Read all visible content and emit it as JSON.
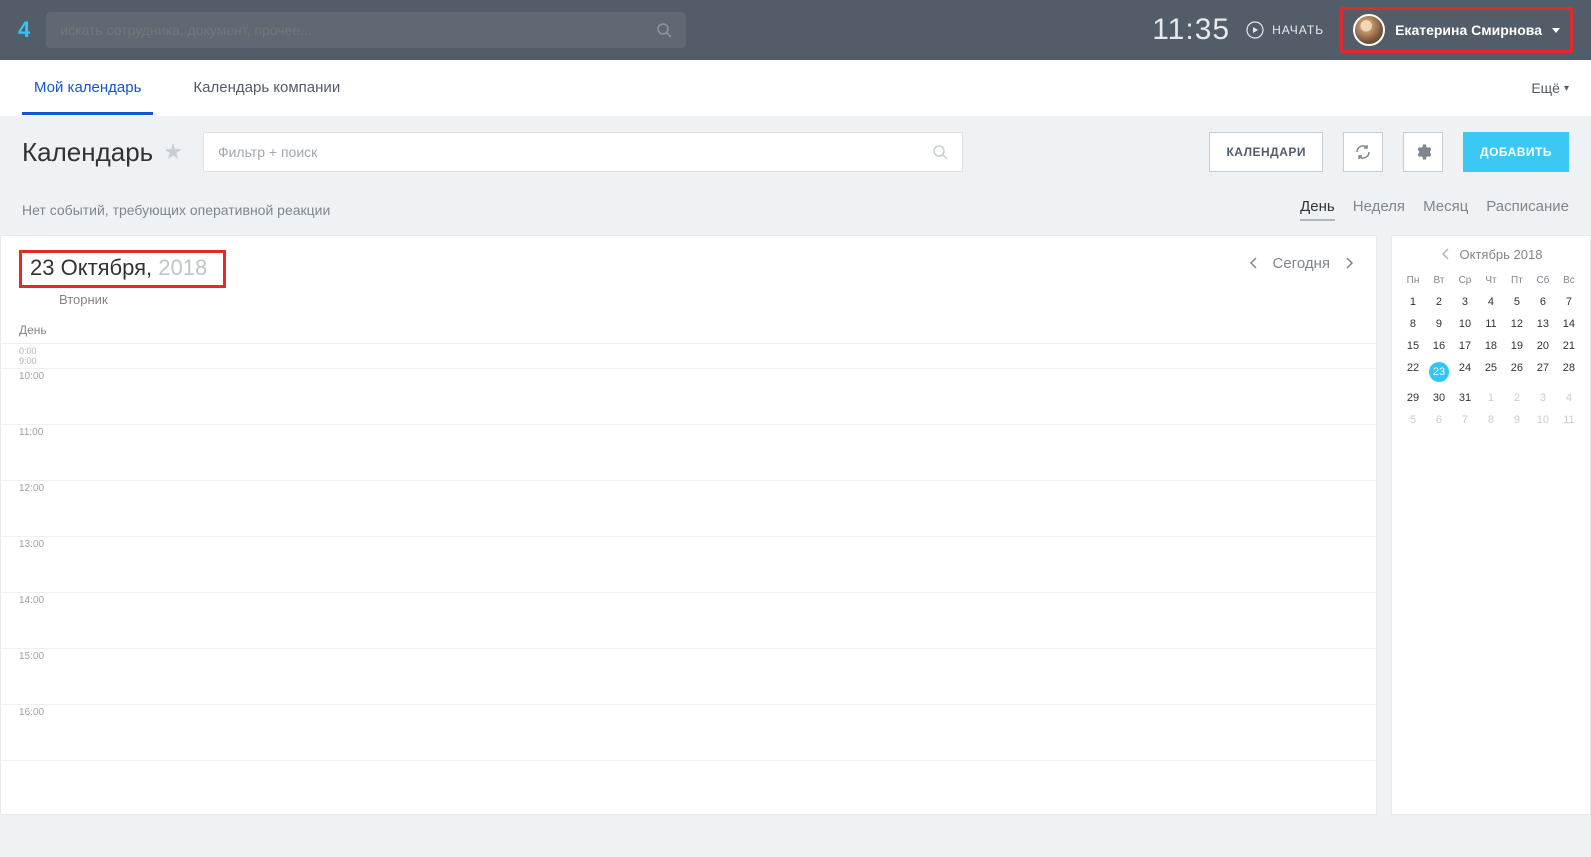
{
  "topbar": {
    "logo": "4",
    "search_placeholder": "искать сотрудника, документ, прочее...",
    "clock": "11:35",
    "start_label": "НАЧАТЬ",
    "user_name": "Екатерина Смирнова"
  },
  "tabs": {
    "items": [
      {
        "label": "Мой календарь",
        "active": true
      },
      {
        "label": "Календарь компании",
        "active": false
      }
    ],
    "more": "Ещё"
  },
  "header": {
    "title": "Календарь",
    "filter_placeholder": "Фильтр + поиск",
    "calendars_btn": "КАЛЕНДАРИ",
    "add_btn": "ДОБАВИТЬ"
  },
  "subrow": {
    "no_events": "Нет событий, требующих оперативной реакции",
    "views": [
      "День",
      "Неделя",
      "Месяц",
      "Расписание"
    ],
    "active_view": "День"
  },
  "day": {
    "date_main": "23 Октября,",
    "date_year": " 2018",
    "day_name": "Вторник",
    "today": "Сегодня",
    "day_label": "День",
    "top_time1": "0:00",
    "top_time2": "9:00",
    "hours": [
      "10:00",
      "11:00",
      "12:00",
      "13:00",
      "14:00",
      "15:00",
      "16:00"
    ]
  },
  "mini": {
    "title": "Октябрь 2018",
    "weekdays": [
      "Пн",
      "Вт",
      "Ср",
      "Чт",
      "Пт",
      "Сб",
      "Вс"
    ],
    "weeks": [
      [
        {
          "d": "1"
        },
        {
          "d": "2"
        },
        {
          "d": "3"
        },
        {
          "d": "4"
        },
        {
          "d": "5"
        },
        {
          "d": "6"
        },
        {
          "d": "7"
        }
      ],
      [
        {
          "d": "8"
        },
        {
          "d": "9"
        },
        {
          "d": "10"
        },
        {
          "d": "11"
        },
        {
          "d": "12"
        },
        {
          "d": "13"
        },
        {
          "d": "14"
        }
      ],
      [
        {
          "d": "15"
        },
        {
          "d": "16"
        },
        {
          "d": "17"
        },
        {
          "d": "18"
        },
        {
          "d": "19"
        },
        {
          "d": "20"
        },
        {
          "d": "21"
        }
      ],
      [
        {
          "d": "22"
        },
        {
          "d": "23",
          "today": true
        },
        {
          "d": "24"
        },
        {
          "d": "25"
        },
        {
          "d": "26"
        },
        {
          "d": "27"
        },
        {
          "d": "28"
        }
      ],
      [
        {
          "d": "29"
        },
        {
          "d": "30"
        },
        {
          "d": "31"
        },
        {
          "d": "1",
          "other": true
        },
        {
          "d": "2",
          "other": true
        },
        {
          "d": "3",
          "other": true
        },
        {
          "d": "4",
          "other": true
        }
      ],
      [
        {
          "d": "5",
          "other": true
        },
        {
          "d": "6",
          "other": true
        },
        {
          "d": "7",
          "other": true
        },
        {
          "d": "8",
          "other": true
        },
        {
          "d": "9",
          "other": true
        },
        {
          "d": "10",
          "other": true
        },
        {
          "d": "11",
          "other": true
        }
      ]
    ]
  }
}
